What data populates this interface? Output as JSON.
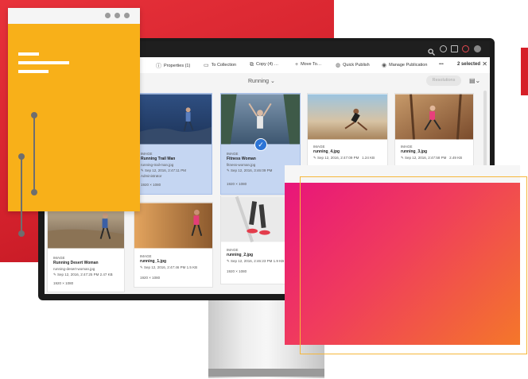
{
  "toolbar": {
    "items": [
      "Properties (1)",
      "To Collection",
      "Copy (4) …",
      "Move To…",
      "Quick Publish",
      "Manage Publication"
    ],
    "more": "•••",
    "selected": "2 selected",
    "close": "✕"
  },
  "folder": {
    "label": "Running ⌄"
  },
  "subbar": {
    "resolve": "Resolutions"
  },
  "cards": [
    {
      "type": "IMAGE",
      "title": "Running Trail Man",
      "file": "running-trail-man.jpg",
      "date": "Sep 12, 2016, 2:47:11 PM",
      "extra": "Administrator",
      "size": "1920 × 1080",
      "selected": true
    },
    {
      "type": "IMAGE",
      "title": "Fitness Woman",
      "file": "fitness-woman.jpg",
      "date": "Sep 12, 2016, 3:46:09 PM",
      "extra": "",
      "size": "1920 × 1080",
      "selected": true
    },
    {
      "type": "IMAGE",
      "title": "running_4.jpg",
      "file": "",
      "date": "Sep 12, 2016, 2:47:09 PM",
      "extra": "1.24 KB",
      "size": "",
      "selected": false
    },
    {
      "type": "IMAGE",
      "title": "running_3.jpg",
      "file": "",
      "date": "Sep 12, 2016, 2:47:58 PM",
      "extra": "2.49 KB",
      "size": "",
      "selected": false
    },
    {
      "type": "IMAGE",
      "title": "Running Desert Woman",
      "file": "running-desert-woman.jpg",
      "date": "Sep 12, 2016, 2:47:25 PM",
      "extra": "2.47 KB",
      "size": "1920 × 1080",
      "selected": false
    },
    {
      "type": "IMAGE",
      "title": "running_1.jpg",
      "file": "",
      "date": "Sep 12, 2016, 2:47:46 PM",
      "extra": "1.5 KB",
      "size": "1920 × 1080",
      "selected": false
    },
    {
      "type": "IMAGE",
      "title": "running_2.jpg",
      "file": "",
      "date": "Sep 12, 2016, 2:46:23 PM",
      "extra": "1.9 KB",
      "size": "1920 × 1080",
      "selected": false
    }
  ]
}
